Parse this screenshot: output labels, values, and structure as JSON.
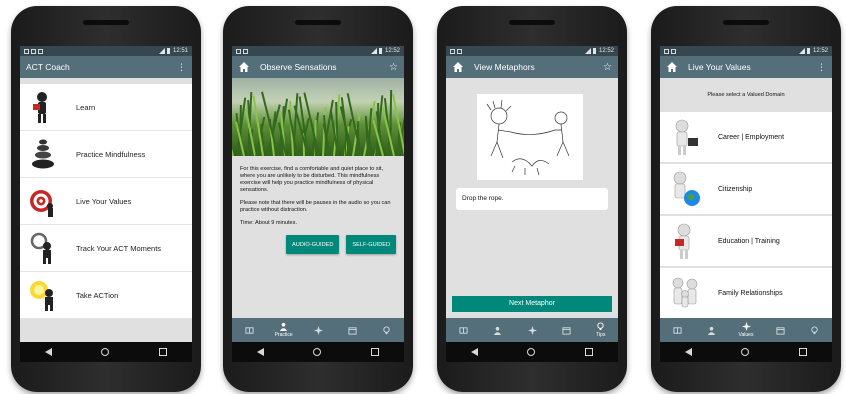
{
  "phones": {
    "p1": {
      "status_time": "12:51",
      "title": "ACT Coach",
      "menu": [
        "Learn",
        "Practice Mindfulness",
        "Live Your Values",
        "Track Your ACT Moments",
        "Take ACTion"
      ]
    },
    "p2": {
      "status_time": "12:52",
      "title": "Observe Sensations",
      "paragraph1": "For this exercise, find a comfortable and quiet place to sit, where you are unlikely to be disturbed. This mindfulness exercise will help you practice mindfulness of physical sensations.",
      "paragraph2": "Please note that there will be pauses in the audio so you can practice without distraction.",
      "time_text": "Time: About 9 minutes.",
      "audio_button": "AUDIO-GUIDED",
      "self_button": "SELF-GUIDED",
      "active_tab_label": "Practice"
    },
    "p3": {
      "status_time": "12:52",
      "title": "View Metaphors",
      "metaphor": "Drop the rope.",
      "next_button": "Next Metaphor",
      "active_tab_label": "Tips"
    },
    "p4": {
      "status_time": "12:52",
      "title": "Live Your Values",
      "prompt": "Please select a Valued Domain",
      "domains": [
        "Career | Employment",
        "Citizenship",
        "Education | Training",
        "Family Relationships"
      ],
      "active_tab_label": "Values"
    }
  },
  "colors": {
    "appbar": "#546e7a",
    "statusbar": "#37474f",
    "accent": "#00897b",
    "content_bg": "#e0e0e0"
  }
}
